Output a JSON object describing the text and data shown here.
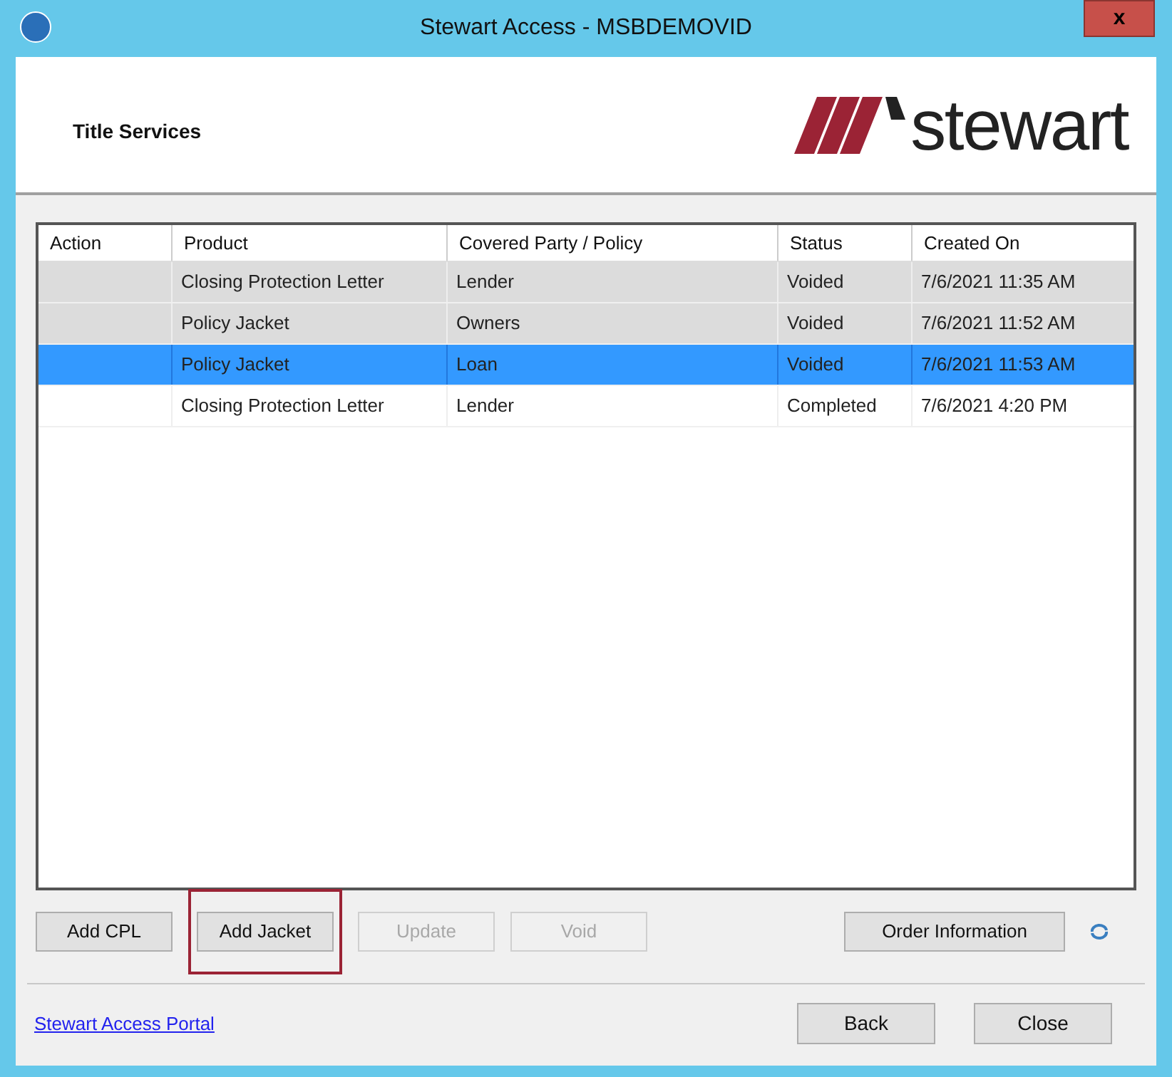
{
  "window": {
    "title": "Stewart Access - MSBDEMOVID",
    "close": "x"
  },
  "header": {
    "title": "Title Services",
    "logo_text": "stewart"
  },
  "table": {
    "columns": [
      "Action",
      "Product",
      "Covered Party / Policy",
      "Status",
      "Created On"
    ],
    "rows": [
      {
        "cells": [
          "",
          "Closing Protection Letter",
          "Lender",
          "Voided",
          "7/6/2021 11:35 AM"
        ],
        "disabled": true,
        "selected": false
      },
      {
        "cells": [
          "",
          "Policy Jacket",
          "Owners",
          "Voided",
          "7/6/2021 11:52 AM"
        ],
        "disabled": true,
        "selected": false
      },
      {
        "cells": [
          "",
          "Policy Jacket",
          "Loan",
          "Voided",
          "7/6/2021 11:53 AM"
        ],
        "disabled": true,
        "selected": true
      },
      {
        "cells": [
          "",
          "Closing Protection Letter",
          "Lender",
          "Completed",
          "7/6/2021 4:20 PM"
        ],
        "disabled": false,
        "selected": false
      }
    ]
  },
  "actions": [
    {
      "label": "Add CPL",
      "disabled": false,
      "highlighted": false
    },
    {
      "label": "Add Jacket",
      "disabled": false,
      "highlighted": true
    },
    {
      "label": "Update",
      "disabled": true,
      "highlighted": false
    },
    {
      "label": "Void",
      "disabled": true,
      "highlighted": false
    }
  ],
  "order_button": "Order Information",
  "footer": {
    "link": "Stewart Access Portal",
    "buttons": [
      "Back",
      "Close"
    ]
  }
}
